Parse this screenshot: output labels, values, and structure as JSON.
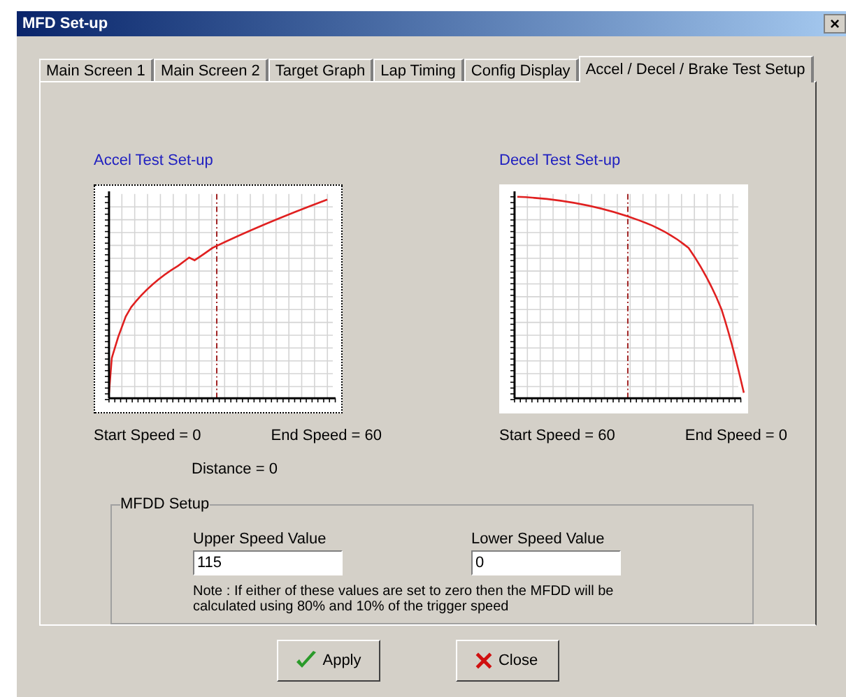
{
  "window": {
    "title": "MFD Set-up",
    "close": "×"
  },
  "tabs": [
    {
      "label": "Main Screen 1",
      "selected": false
    },
    {
      "label": "Main Screen 2",
      "selected": false
    },
    {
      "label": "Target Graph",
      "selected": false
    },
    {
      "label": "Lap Timing",
      "selected": false
    },
    {
      "label": "Config Display",
      "selected": false
    },
    {
      "label": "Accel / Decel / Brake Test Setup",
      "selected": true
    }
  ],
  "accel": {
    "title": "Accel Test Set-up",
    "start": "Start Speed =  0",
    "end": "End Speed = 60",
    "distance": "Distance =  0"
  },
  "decel": {
    "title": "Decel Test Set-up",
    "start": "Start Speed =  60",
    "end": "End Speed = 0"
  },
  "mfdd": {
    "title": "MFDD Setup",
    "upper_label": "Upper Speed Value",
    "upper_value": "115",
    "lower_label": "Lower Speed Value",
    "lower_value": "0",
    "note": "Note : If either of these values are set to zero then the MFDD will be calculated using 80% and 10% of the trigger speed"
  },
  "buttons": [
    {
      "label": "Apply",
      "kind": "apply"
    },
    {
      "label": "Close",
      "kind": "close"
    }
  ]
}
